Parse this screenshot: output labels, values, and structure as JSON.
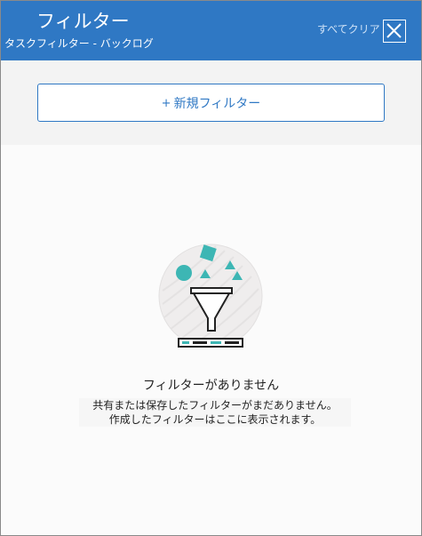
{
  "header": {
    "title": "フィルター",
    "subtitle": "タスクフィルター - バックログ",
    "clear_all": "すべてクリア",
    "close_icon": "close-icon"
  },
  "toolbar": {
    "new_filter_plus": "+",
    "new_filter_label": "新規フィルター"
  },
  "empty_state": {
    "illustration_icon": "funnel-icon",
    "title": "フィルターがありません",
    "line1": "共有または保存したフィルターがまだありません。",
    "line2": "作成したフィルターはここに表示されます。"
  },
  "colors": {
    "header_bg": "#2f78c4",
    "accent": "#2f78c4",
    "teal": "#3db6b4"
  }
}
